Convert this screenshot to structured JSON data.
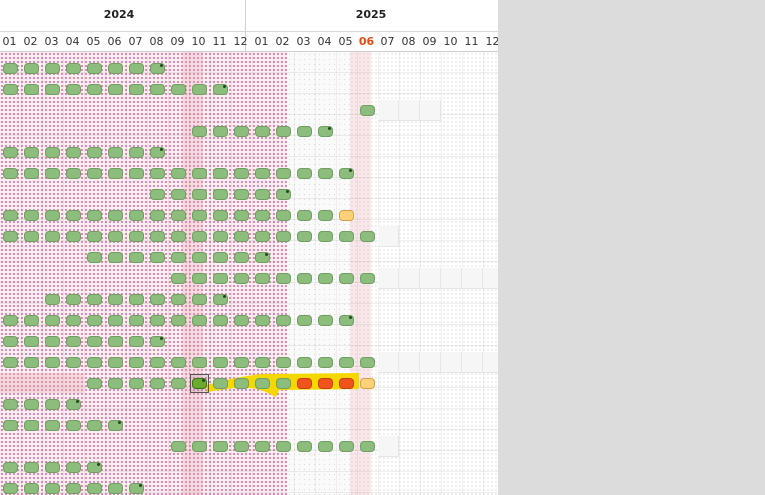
{
  "years": [
    {
      "label": "2024",
      "months": [
        "01",
        "02",
        "03",
        "04",
        "05",
        "06",
        "07",
        "08",
        "09",
        "10",
        "11",
        "12"
      ]
    },
    {
      "label": "2025",
      "months": [
        "01",
        "02",
        "03",
        "04",
        "05",
        "06",
        "07",
        "08",
        "09",
        "10",
        "11",
        "12"
      ]
    }
  ],
  "current_month": {
    "year": "2025",
    "month": "06"
  },
  "colors": {
    "done": "#8cbd7c",
    "pending": "#ffd27a",
    "alert": "#f0531c",
    "selected": "#6aaa2c",
    "highlight_path": "#f5d800",
    "past_pattern": "#c3347a",
    "current_month_text": "#e24b12"
  },
  "rows": [
    {
      "start": 0,
      "end": 7,
      "marker": "end"
    },
    {
      "start": 0,
      "end": 10,
      "marker": "end"
    },
    {
      "start": 17,
      "end": 17,
      "empty_until": 20
    },
    {
      "start": 9,
      "end": 15,
      "marker": "end"
    },
    {
      "start": 0,
      "end": 7,
      "marker": "end"
    },
    {
      "start": 0,
      "end": 16,
      "marker": "end"
    },
    {
      "start": 7,
      "end": 13,
      "marker": "end"
    },
    {
      "start": 0,
      "end": 16,
      "pending_last": true
    },
    {
      "start": 0,
      "end": 17,
      "empty_until": 18
    },
    {
      "start": 4,
      "end": 12,
      "marker": "end"
    },
    {
      "start": 8,
      "end": 17,
      "empty_until": 23
    },
    {
      "start": 2,
      "end": 10,
      "marker": "end"
    },
    {
      "start": 0,
      "end": 16,
      "marker": "end"
    },
    {
      "start": 0,
      "end": 7,
      "marker": "end"
    },
    {
      "start": 0,
      "end": 17,
      "empty_until": 23
    },
    {
      "start": 4,
      "end": 17,
      "selected_col": 9,
      "alert_cols": [
        14,
        15,
        16
      ],
      "pending_last": true,
      "highlight": true
    },
    {
      "start": 0,
      "end": 3,
      "marker": "end"
    },
    {
      "start": 0,
      "end": 5,
      "marker": "end"
    },
    {
      "start": 8,
      "end": 17,
      "empty_until": 18
    },
    {
      "start": 0,
      "end": 4,
      "marker": "end"
    },
    {
      "start": 0,
      "end": 6,
      "marker": "end"
    }
  ]
}
